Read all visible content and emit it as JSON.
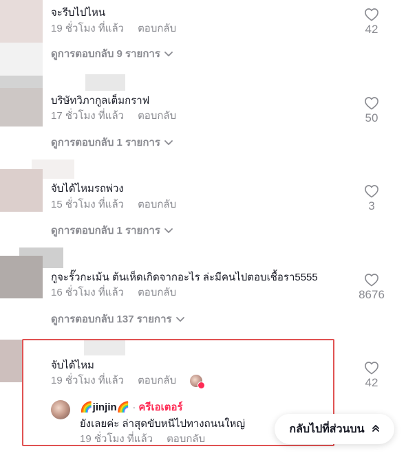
{
  "comments": [
    {
      "text": "จะรีบไปไหน",
      "time": "19 ชั่วโมง ที่แล้ว",
      "reply_label": "ตอบกลับ",
      "view_replies": "ดูการตอบกลับ 9 รายการ",
      "likes": "42"
    },
    {
      "text": "บริษัทวิภากูลเต็มกราฟ",
      "time": "17 ชั่วโมง ที่แล้ว",
      "reply_label": "ตอบกลับ",
      "view_replies": "ดูการตอบกลับ 1 รายการ",
      "likes": "50"
    },
    {
      "text": "จับได้ไหมรถพ่วง",
      "time": "15 ชั่วโมง ที่แล้ว",
      "reply_label": "ตอบกลับ",
      "view_replies": "ดูการตอบกลับ 1 รายการ",
      "likes": "3"
    },
    {
      "text": "กูจะรั๊วกะเม้น ต้นเห็ดเกิดจากอะไร ล่ะมีคนไปตอบเชื้อรา5555",
      "time": "16 ชั่วโมง ที่แล้ว",
      "reply_label": "ตอบกลับ",
      "view_replies": "ดูการตอบกลับ 137 รายการ",
      "likes": "8676"
    },
    {
      "text": "จับได้ไหม",
      "time": "19 ชั่วโมง ที่แล้ว",
      "reply_label": "ตอบกลับ",
      "likes": "42"
    }
  ],
  "creator_reply": {
    "username": "🌈jinjin🌈",
    "separator": "·",
    "badge": "ครีเอเตอร์",
    "text": "ยังเลยค่ะ ล่าสุดขับหนีไปทางถนนใหญ่",
    "time": "19 ชั่วโมง ที่แล้ว",
    "reply_label": "ตอบกลับ"
  },
  "back_to_top": {
    "label": "กลับไปที่ส่วนบน",
    "icon": "chevrons-up-icon"
  },
  "colors": {
    "highlight_border": "#e05252",
    "creator_badge": "#fe2c55",
    "meta_text": "#8a8b91"
  }
}
